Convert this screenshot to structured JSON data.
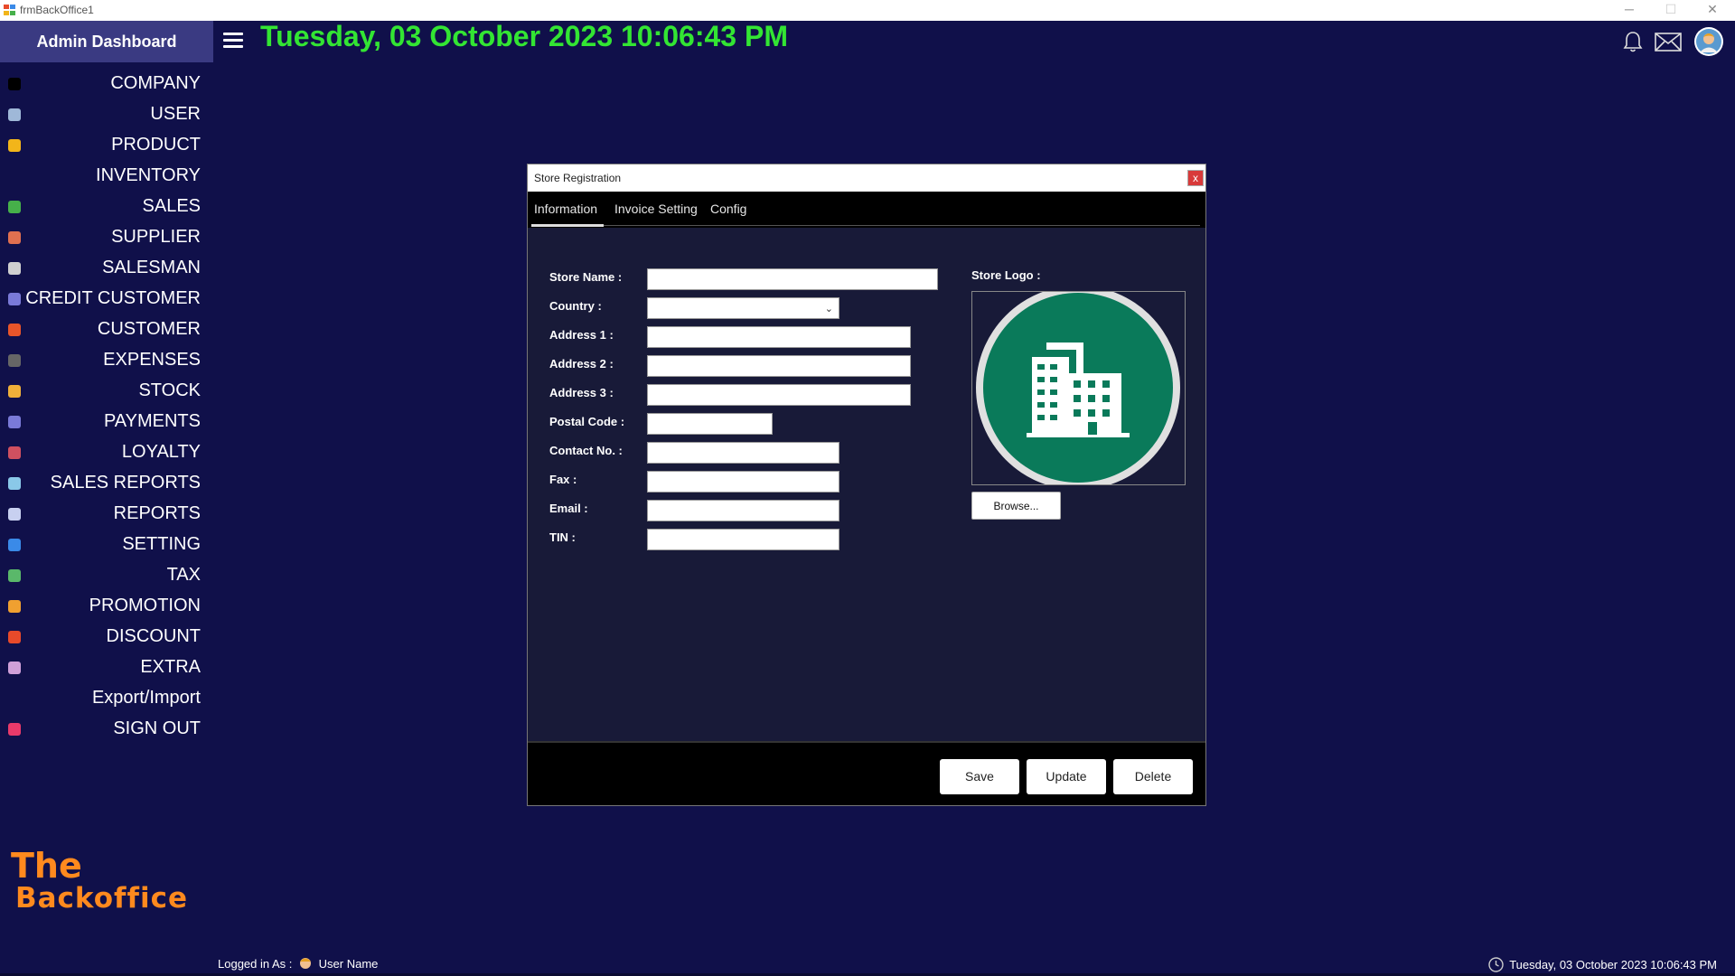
{
  "window": {
    "title": "frmBackOffice1",
    "minimize": "─",
    "maximize": "☐",
    "close": "✕"
  },
  "sidebar": {
    "header": "Admin Dashboard",
    "items": [
      {
        "label": "COMPANY",
        "icon": "company-icon",
        "color": "#000000"
      },
      {
        "label": "USER",
        "icon": "user-icon",
        "color": "#9fb8d8"
      },
      {
        "label": "PRODUCT",
        "icon": "product-icon",
        "color": "#f2b51a"
      },
      {
        "label": "INVENTORY",
        "icon": "inventory-icon",
        "color": ""
      },
      {
        "label": "SALES",
        "icon": "sales-icon",
        "color": "#46b04a"
      },
      {
        "label": "SUPPLIER",
        "icon": "supplier-icon",
        "color": "#e07050"
      },
      {
        "label": "SALESMAN",
        "icon": "salesman-icon",
        "color": "#d0d0d0"
      },
      {
        "label": "CREDIT CUSTOMER",
        "icon": "credit-customer-icon",
        "color": "#7a7ad8"
      },
      {
        "label": "CUSTOMER",
        "icon": "customer-icon",
        "color": "#e8552a"
      },
      {
        "label": "EXPENSES",
        "icon": "expenses-icon",
        "color": "#666666"
      },
      {
        "label": "STOCK",
        "icon": "stock-icon",
        "color": "#f0b03a"
      },
      {
        "label": "PAYMENTS",
        "icon": "payments-icon",
        "color": "#7a7ad8"
      },
      {
        "label": "LOYALTY",
        "icon": "loyalty-icon",
        "color": "#d05060"
      },
      {
        "label": "SALES REPORTS",
        "icon": "sales-reports-icon",
        "color": "#8ac8e8"
      },
      {
        "label": "REPORTS",
        "icon": "reports-icon",
        "color": "#c8d0f0"
      },
      {
        "label": "SETTING",
        "icon": "gear-icon",
        "color": "#3a8ae8"
      },
      {
        "label": "TAX",
        "icon": "tax-icon",
        "color": "#5ab86a"
      },
      {
        "label": "PROMOTION",
        "icon": "promotion-icon",
        "color": "#f0a030"
      },
      {
        "label": "DISCOUNT",
        "icon": "discount-icon",
        "color": "#e84a2a"
      },
      {
        "label": "EXTRA",
        "icon": "extra-icon",
        "color": "#d0a0d8"
      },
      {
        "label": "Export/Import",
        "icon": "export-import-icon",
        "color": ""
      },
      {
        "label": "SIGN OUT",
        "icon": "sign-out-icon",
        "color": "#e83a6a"
      }
    ]
  },
  "header": {
    "datetime": "Tuesday, 03 October 2023 10:06:43 PM"
  },
  "brand": {
    "line1": "The",
    "line2": "Backoffice"
  },
  "dialog": {
    "title": "Store Registration",
    "close": "x",
    "tabs": [
      {
        "label": "Information",
        "active": true
      },
      {
        "label": "Invoice Setting",
        "active": false
      },
      {
        "label": "Config",
        "active": false
      }
    ],
    "fields": {
      "store_name": {
        "label": "Store Name :",
        "value": ""
      },
      "country": {
        "label": "Country :",
        "value": ""
      },
      "address1": {
        "label": "Address 1 :",
        "value": ""
      },
      "address2": {
        "label": "Address 2 :",
        "value": ""
      },
      "address3": {
        "label": "Address 3 :",
        "value": ""
      },
      "postal_code": {
        "label": "Postal Code :",
        "value": ""
      },
      "contact_no": {
        "label": "Contact No. :",
        "value": ""
      },
      "fax": {
        "label": "Fax :",
        "value": ""
      },
      "email": {
        "label": "Email :",
        "value": ""
      },
      "tin": {
        "label": "TIN :",
        "value": ""
      }
    },
    "store_logo_label": "Store Logo :",
    "logo_colors": {
      "ring": "#e0e0e0",
      "fill": "#0a7a5a",
      "building": "#ffffff"
    },
    "browse": "Browse...",
    "buttons": {
      "save": "Save",
      "update": "Update",
      "delete": "Delete"
    }
  },
  "status": {
    "logged_in_label": "Logged in As :",
    "user": "User Name",
    "datetime": "Tuesday, 03 October 2023 10:06:43 PM"
  },
  "colors": {
    "background": "#10104a",
    "sidebar_header": "#3a3a82",
    "clock": "#33e533",
    "brand": "#ff8a1e"
  }
}
